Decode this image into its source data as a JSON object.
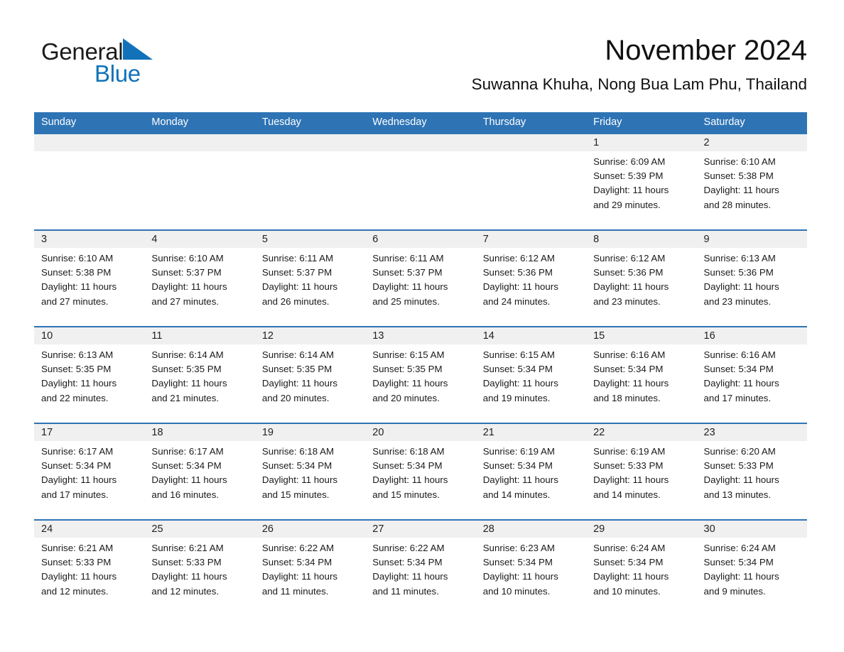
{
  "brand": {
    "name_part1": "General",
    "name_part2": "Blue",
    "logo_icon": "triangle-icon",
    "accent_color": "#1172BA"
  },
  "header": {
    "title": "November 2024",
    "subtitle": "Suwanna Khuha, Nong Bua Lam Phu, Thailand"
  },
  "theme": {
    "header_blue": "#2E74B5",
    "date_band_gray": "#f0f0f0"
  },
  "calendar": {
    "weekdays": [
      "Sunday",
      "Monday",
      "Tuesday",
      "Wednesday",
      "Thursday",
      "Friday",
      "Saturday"
    ],
    "weeks": [
      [
        {
          "day": "",
          "sunrise": "",
          "sunset": "",
          "daylight_line1": "",
          "daylight_line2": ""
        },
        {
          "day": "",
          "sunrise": "",
          "sunset": "",
          "daylight_line1": "",
          "daylight_line2": ""
        },
        {
          "day": "",
          "sunrise": "",
          "sunset": "",
          "daylight_line1": "",
          "daylight_line2": ""
        },
        {
          "day": "",
          "sunrise": "",
          "sunset": "",
          "daylight_line1": "",
          "daylight_line2": ""
        },
        {
          "day": "",
          "sunrise": "",
          "sunset": "",
          "daylight_line1": "",
          "daylight_line2": ""
        },
        {
          "day": "1",
          "sunrise": "Sunrise: 6:09 AM",
          "sunset": "Sunset: 5:39 PM",
          "daylight_line1": "Daylight: 11 hours",
          "daylight_line2": "and 29 minutes."
        },
        {
          "day": "2",
          "sunrise": "Sunrise: 6:10 AM",
          "sunset": "Sunset: 5:38 PM",
          "daylight_line1": "Daylight: 11 hours",
          "daylight_line2": "and 28 minutes."
        }
      ],
      [
        {
          "day": "3",
          "sunrise": "Sunrise: 6:10 AM",
          "sunset": "Sunset: 5:38 PM",
          "daylight_line1": "Daylight: 11 hours",
          "daylight_line2": "and 27 minutes."
        },
        {
          "day": "4",
          "sunrise": "Sunrise: 6:10 AM",
          "sunset": "Sunset: 5:37 PM",
          "daylight_line1": "Daylight: 11 hours",
          "daylight_line2": "and 27 minutes."
        },
        {
          "day": "5",
          "sunrise": "Sunrise: 6:11 AM",
          "sunset": "Sunset: 5:37 PM",
          "daylight_line1": "Daylight: 11 hours",
          "daylight_line2": "and 26 minutes."
        },
        {
          "day": "6",
          "sunrise": "Sunrise: 6:11 AM",
          "sunset": "Sunset: 5:37 PM",
          "daylight_line1": "Daylight: 11 hours",
          "daylight_line2": "and 25 minutes."
        },
        {
          "day": "7",
          "sunrise": "Sunrise: 6:12 AM",
          "sunset": "Sunset: 5:36 PM",
          "daylight_line1": "Daylight: 11 hours",
          "daylight_line2": "and 24 minutes."
        },
        {
          "day": "8",
          "sunrise": "Sunrise: 6:12 AM",
          "sunset": "Sunset: 5:36 PM",
          "daylight_line1": "Daylight: 11 hours",
          "daylight_line2": "and 23 minutes."
        },
        {
          "day": "9",
          "sunrise": "Sunrise: 6:13 AM",
          "sunset": "Sunset: 5:36 PM",
          "daylight_line1": "Daylight: 11 hours",
          "daylight_line2": "and 23 minutes."
        }
      ],
      [
        {
          "day": "10",
          "sunrise": "Sunrise: 6:13 AM",
          "sunset": "Sunset: 5:35 PM",
          "daylight_line1": "Daylight: 11 hours",
          "daylight_line2": "and 22 minutes."
        },
        {
          "day": "11",
          "sunrise": "Sunrise: 6:14 AM",
          "sunset": "Sunset: 5:35 PM",
          "daylight_line1": "Daylight: 11 hours",
          "daylight_line2": "and 21 minutes."
        },
        {
          "day": "12",
          "sunrise": "Sunrise: 6:14 AM",
          "sunset": "Sunset: 5:35 PM",
          "daylight_line1": "Daylight: 11 hours",
          "daylight_line2": "and 20 minutes."
        },
        {
          "day": "13",
          "sunrise": "Sunrise: 6:15 AM",
          "sunset": "Sunset: 5:35 PM",
          "daylight_line1": "Daylight: 11 hours",
          "daylight_line2": "and 20 minutes."
        },
        {
          "day": "14",
          "sunrise": "Sunrise: 6:15 AM",
          "sunset": "Sunset: 5:34 PM",
          "daylight_line1": "Daylight: 11 hours",
          "daylight_line2": "and 19 minutes."
        },
        {
          "day": "15",
          "sunrise": "Sunrise: 6:16 AM",
          "sunset": "Sunset: 5:34 PM",
          "daylight_line1": "Daylight: 11 hours",
          "daylight_line2": "and 18 minutes."
        },
        {
          "day": "16",
          "sunrise": "Sunrise: 6:16 AM",
          "sunset": "Sunset: 5:34 PM",
          "daylight_line1": "Daylight: 11 hours",
          "daylight_line2": "and 17 minutes."
        }
      ],
      [
        {
          "day": "17",
          "sunrise": "Sunrise: 6:17 AM",
          "sunset": "Sunset: 5:34 PM",
          "daylight_line1": "Daylight: 11 hours",
          "daylight_line2": "and 17 minutes."
        },
        {
          "day": "18",
          "sunrise": "Sunrise: 6:17 AM",
          "sunset": "Sunset: 5:34 PM",
          "daylight_line1": "Daylight: 11 hours",
          "daylight_line2": "and 16 minutes."
        },
        {
          "day": "19",
          "sunrise": "Sunrise: 6:18 AM",
          "sunset": "Sunset: 5:34 PM",
          "daylight_line1": "Daylight: 11 hours",
          "daylight_line2": "and 15 minutes."
        },
        {
          "day": "20",
          "sunrise": "Sunrise: 6:18 AM",
          "sunset": "Sunset: 5:34 PM",
          "daylight_line1": "Daylight: 11 hours",
          "daylight_line2": "and 15 minutes."
        },
        {
          "day": "21",
          "sunrise": "Sunrise: 6:19 AM",
          "sunset": "Sunset: 5:34 PM",
          "daylight_line1": "Daylight: 11 hours",
          "daylight_line2": "and 14 minutes."
        },
        {
          "day": "22",
          "sunrise": "Sunrise: 6:19 AM",
          "sunset": "Sunset: 5:33 PM",
          "daylight_line1": "Daylight: 11 hours",
          "daylight_line2": "and 14 minutes."
        },
        {
          "day": "23",
          "sunrise": "Sunrise: 6:20 AM",
          "sunset": "Sunset: 5:33 PM",
          "daylight_line1": "Daylight: 11 hours",
          "daylight_line2": "and 13 minutes."
        }
      ],
      [
        {
          "day": "24",
          "sunrise": "Sunrise: 6:21 AM",
          "sunset": "Sunset: 5:33 PM",
          "daylight_line1": "Daylight: 11 hours",
          "daylight_line2": "and 12 minutes."
        },
        {
          "day": "25",
          "sunrise": "Sunrise: 6:21 AM",
          "sunset": "Sunset: 5:33 PM",
          "daylight_line1": "Daylight: 11 hours",
          "daylight_line2": "and 12 minutes."
        },
        {
          "day": "26",
          "sunrise": "Sunrise: 6:22 AM",
          "sunset": "Sunset: 5:34 PM",
          "daylight_line1": "Daylight: 11 hours",
          "daylight_line2": "and 11 minutes."
        },
        {
          "day": "27",
          "sunrise": "Sunrise: 6:22 AM",
          "sunset": "Sunset: 5:34 PM",
          "daylight_line1": "Daylight: 11 hours",
          "daylight_line2": "and 11 minutes."
        },
        {
          "day": "28",
          "sunrise": "Sunrise: 6:23 AM",
          "sunset": "Sunset: 5:34 PM",
          "daylight_line1": "Daylight: 11 hours",
          "daylight_line2": "and 10 minutes."
        },
        {
          "day": "29",
          "sunrise": "Sunrise: 6:24 AM",
          "sunset": "Sunset: 5:34 PM",
          "daylight_line1": "Daylight: 11 hours",
          "daylight_line2": "and 10 minutes."
        },
        {
          "day": "30",
          "sunrise": "Sunrise: 6:24 AM",
          "sunset": "Sunset: 5:34 PM",
          "daylight_line1": "Daylight: 11 hours",
          "daylight_line2": "and 9 minutes."
        }
      ]
    ]
  }
}
